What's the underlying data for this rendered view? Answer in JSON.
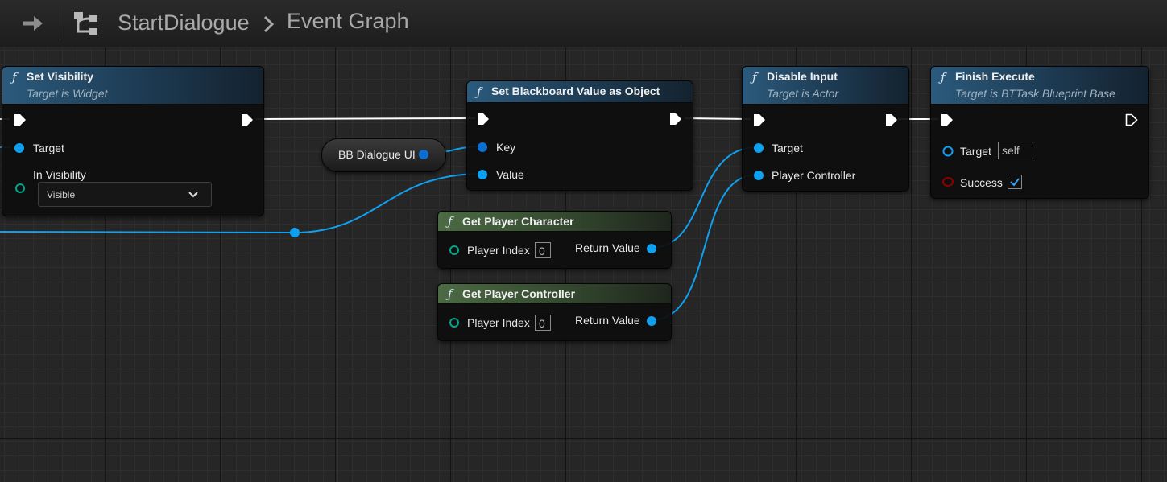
{
  "breadcrumb": {
    "blueprint": "StartDialogue",
    "graph": "Event Graph"
  },
  "nodes": {
    "set_visibility": {
      "title": "Set Visibility",
      "subtitle": "Target is Widget",
      "target_label": "Target",
      "visibility_label": "In Visibility",
      "visibility_value": "Visible"
    },
    "set_bb_value": {
      "title": "Set Blackboard Value as Object",
      "key_label": "Key",
      "value_label": "Value"
    },
    "bb_var": {
      "label": "BB Dialogue UI"
    },
    "disable_input": {
      "title": "Disable Input",
      "subtitle": "Target is Actor",
      "target_label": "Target",
      "player_controller_label": "Player Controller"
    },
    "finish_execute": {
      "title": "Finish Execute",
      "subtitle": "Target is BTTask Blueprint Base",
      "target_label": "Target",
      "target_value": "self",
      "success_label": "Success",
      "success_checked": true
    },
    "get_player_character": {
      "title": "Get Player Character",
      "player_index_label": "Player Index",
      "player_index_value": "0",
      "return_label": "Return Value"
    },
    "get_player_controller": {
      "title": "Get Player Controller",
      "player_index_label": "Player Index",
      "player_index_value": "0",
      "return_label": "Return Value"
    }
  },
  "colors": {
    "object_pin": "#10a0f0",
    "exec_wire": "#ffffff",
    "bool_pin": "#8c0000",
    "struct_pin": "#00a58a",
    "function_header": "#2b5a7c",
    "pure_header": "#4c6a44"
  },
  "icons": [
    "back-arrow-icon",
    "blueprint-graph-icon",
    "breadcrumb-chevron-icon",
    "function-icon",
    "exec-pin-icon",
    "object-pin-icon",
    "checkmark-icon",
    "dropdown-chevron-icon"
  ]
}
